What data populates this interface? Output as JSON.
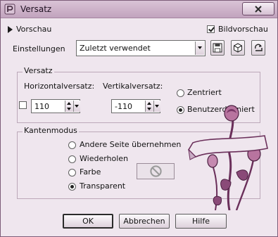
{
  "window": {
    "title": "Versatz"
  },
  "preview": {
    "toggle_label": "Vorschau",
    "image_preview_label": "Bildvorschau",
    "image_preview_checked": true
  },
  "settings": {
    "label": "Einstellungen",
    "selected": "Zuletzt verwendet"
  },
  "offset": {
    "group_title": "Versatz",
    "horizontal_label": "Horizontalversatz:",
    "vertical_label": "Vertikalversatz:",
    "horizontal_value": "110",
    "vertical_value": "-110",
    "centered_label": "Zentriert",
    "custom_label": "Benutzerdefiniert",
    "selected": "Benutzerdefiniert"
  },
  "edge_mode": {
    "group_title": "Kantenmodus",
    "options": [
      "Andere Seite übernehmen",
      "Wiederholen",
      "Farbe",
      "Transparent"
    ],
    "selected": "Transparent"
  },
  "buttons": {
    "ok": "OK",
    "cancel": "Abbrechen",
    "help": "Hilfe"
  },
  "colors": {
    "title_bar": "#c9adc5",
    "dialog_bg": "#efe6ee",
    "accent": "#6a2f5a"
  }
}
